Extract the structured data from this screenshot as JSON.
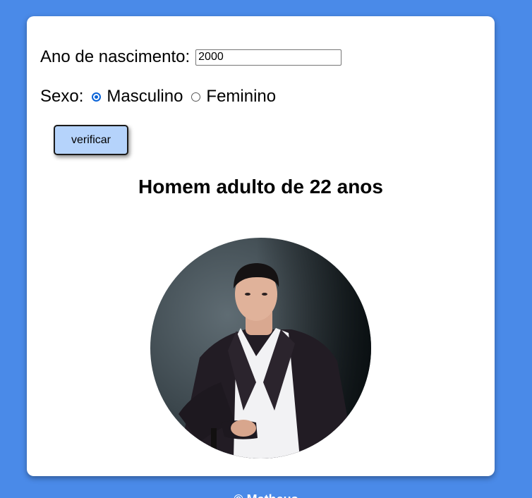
{
  "form": {
    "year_label": "Ano de nascimento:",
    "year_value": "2000",
    "sex_label": "Sexo:",
    "options": [
      {
        "label": "Masculino",
        "checked": true
      },
      {
        "label": "Feminino",
        "checked": false
      }
    ],
    "button_label": "verificar"
  },
  "result": {
    "text": "Homem adulto de 22 anos",
    "image_alt": "man-portrait"
  },
  "footer": {
    "text": "© Matheus"
  },
  "colors": {
    "background": "#4a8ae8",
    "card": "#ffffff",
    "button": "#b5d3fb",
    "radio_accent": "#0b64d8"
  }
}
